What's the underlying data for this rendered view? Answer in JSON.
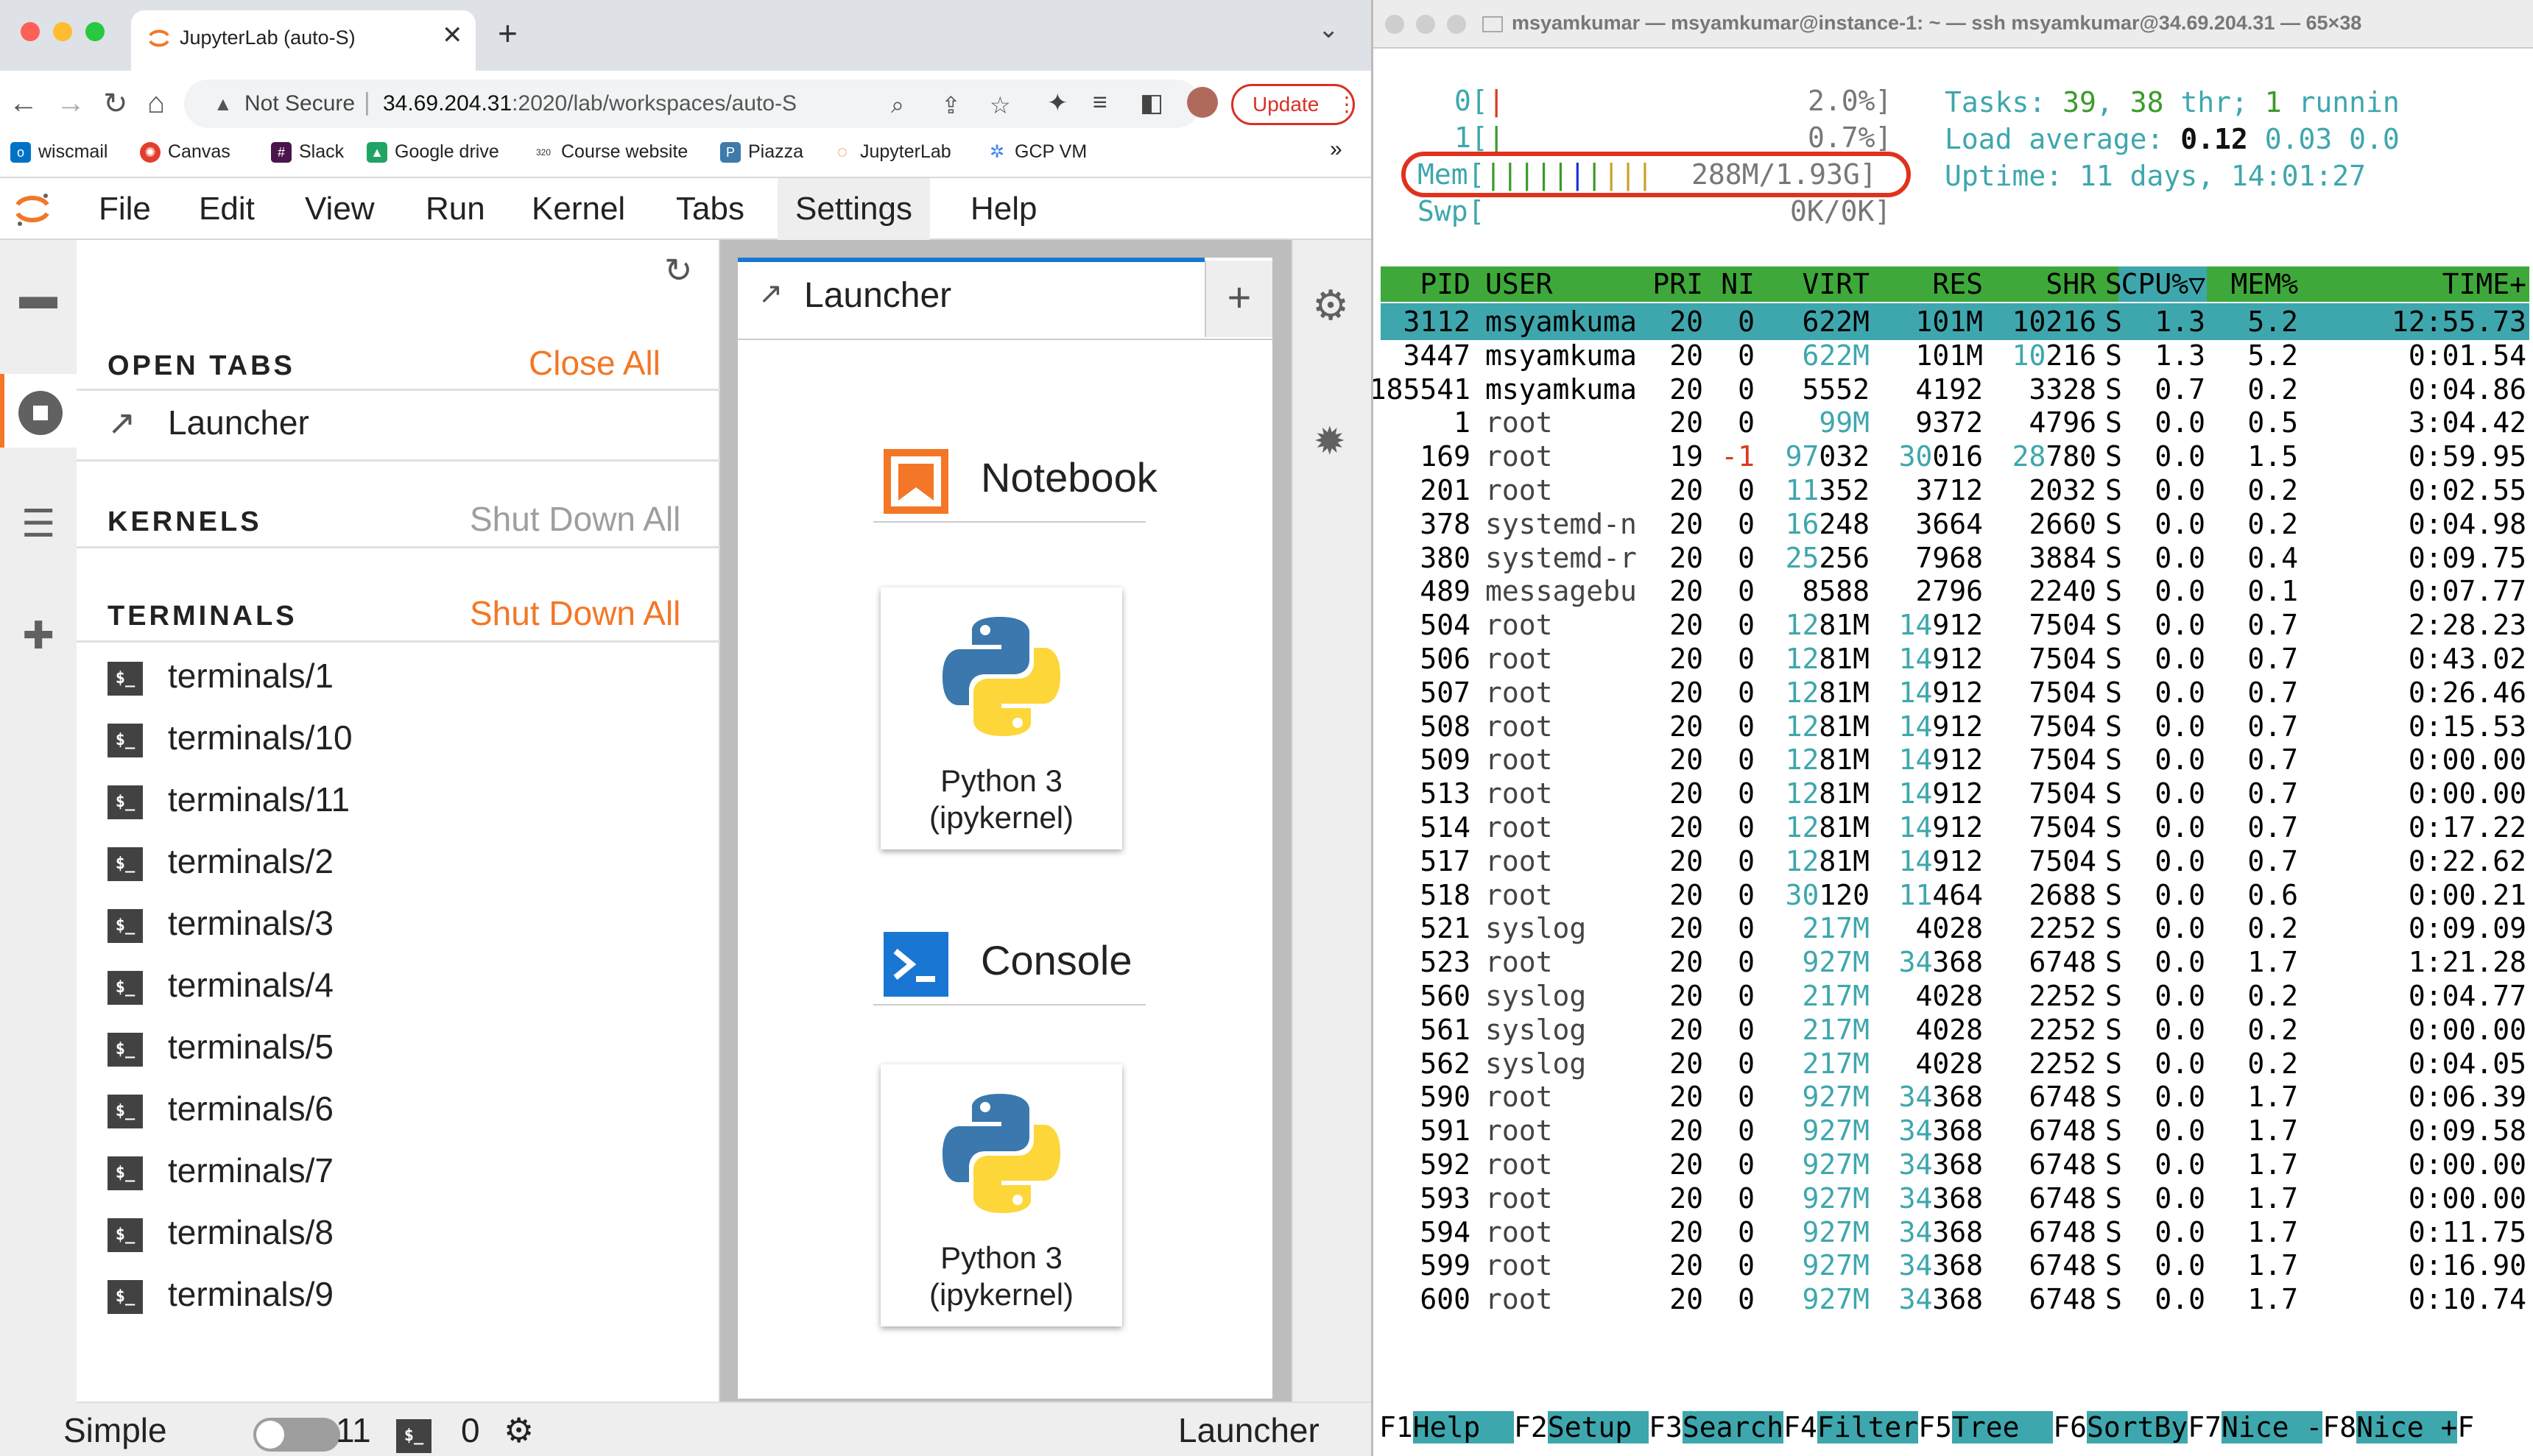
{
  "browser": {
    "tab_title": "JupyterLab (auto-S)",
    "url_security": "Not Secure",
    "url_host": "34.69.204.31",
    "url_path": ":2020/lab/workspaces/auto-S",
    "update_label": "Update",
    "bookmarks": [
      "wiscmail",
      "Canvas",
      "Slack",
      "Google drive",
      "Course website",
      "Piazza",
      "JupyterLab",
      "GCP VM"
    ],
    "bookmarks_more": "»"
  },
  "jupyter": {
    "menus": [
      "File",
      "Edit",
      "View",
      "Run",
      "Kernel",
      "Tabs",
      "Settings",
      "Help"
    ],
    "open_tabs_header": "OPEN TABS",
    "close_all": "Close All",
    "open_tab_item": "Launcher",
    "kernels_header": "KERNELS",
    "kernels_shutdown": "Shut Down All",
    "terminals_header": "TERMINALS",
    "terminals_shutdown": "Shut Down All",
    "terminals": [
      "terminals/1",
      "terminals/10",
      "terminals/11",
      "terminals/2",
      "terminals/3",
      "terminals/4",
      "terminals/5",
      "terminals/6",
      "terminals/7",
      "terminals/8",
      "terminals/9"
    ],
    "terminal_icon_text": "$_",
    "launcher_tab": "Launcher",
    "notebook_section": "Notebook",
    "console_section": "Console",
    "kernel_card_line1": "Python 3",
    "kernel_card_line2": "(ipykernel)",
    "status_simple": "Simple",
    "status_count_terminals": "11",
    "status_count_kernels": "0",
    "status_current": "Launcher"
  },
  "terminal": {
    "window_title": "msyamkumar — msyamkumar@instance-1: ~ — ssh msyamkumar@34.69.204.31 — 65×38",
    "cpu0_label": "0[",
    "cpu0_value": "2.0%]",
    "cpu1_label": "1[",
    "cpu1_value": "0.7%]",
    "mem_label": "Mem[",
    "mem_value": "288M/1.93G]",
    "swp_label": "Swp[",
    "swp_value": "0K/0K]",
    "tasks_label": "Tasks: ",
    "tasks_count": "39",
    "tasks_sep": ", ",
    "threads_count": "38",
    "threads_label": " thr; ",
    "running_count": "1",
    "running_label": " runnin",
    "load_label": "Load average: ",
    "load_1": "0.12",
    "load_5": "0.03",
    "load_15": "0.0",
    "uptime_label": "Uptime: ",
    "uptime_value": "11 days, 14:01:27",
    "columns": [
      "PID",
      "USER",
      "PRI",
      "NI",
      "VIRT",
      "RES",
      "SHR",
      "S",
      "CPU%▽",
      "MEM%",
      "TIME+"
    ],
    "processes": [
      [
        "3112",
        "msyamkuma",
        "20",
        "0",
        "622M",
        "101M",
        "10216",
        "S",
        "1.3",
        "5.2",
        "12:55.73"
      ],
      [
        "3447",
        "msyamkuma",
        "20",
        "0",
        "622M",
        "101M",
        "10216",
        "S",
        "1.3",
        "5.2",
        "0:01.54"
      ],
      [
        "185541",
        "msyamkuma",
        "20",
        "0",
        "5552",
        "4192",
        "3328",
        "S",
        "0.7",
        "0.2",
        "0:04.86"
      ],
      [
        "1",
        "root",
        "20",
        "0",
        "99M",
        "9372",
        "4796",
        "S",
        "0.0",
        "0.5",
        "3:04.42"
      ],
      [
        "169",
        "root",
        "19",
        "-1",
        "97032",
        "30016",
        "28780",
        "S",
        "0.0",
        "1.5",
        "0:59.95"
      ],
      [
        "201",
        "root",
        "20",
        "0",
        "11352",
        "3712",
        "2032",
        "S",
        "0.0",
        "0.2",
        "0:02.55"
      ],
      [
        "378",
        "systemd-n",
        "20",
        "0",
        "16248",
        "3664",
        "2660",
        "S",
        "0.0",
        "0.2",
        "0:04.98"
      ],
      [
        "380",
        "systemd-r",
        "20",
        "0",
        "25256",
        "7968",
        "3884",
        "S",
        "0.0",
        "0.4",
        "0:09.75"
      ],
      [
        "489",
        "messagebu",
        "20",
        "0",
        "8588",
        "2796",
        "2240",
        "S",
        "0.0",
        "0.1",
        "0:07.77"
      ],
      [
        "504",
        "root",
        "20",
        "0",
        "1281M",
        "14912",
        "7504",
        "S",
        "0.0",
        "0.7",
        "2:28.23"
      ],
      [
        "506",
        "root",
        "20",
        "0",
        "1281M",
        "14912",
        "7504",
        "S",
        "0.0",
        "0.7",
        "0:43.02"
      ],
      [
        "507",
        "root",
        "20",
        "0",
        "1281M",
        "14912",
        "7504",
        "S",
        "0.0",
        "0.7",
        "0:26.46"
      ],
      [
        "508",
        "root",
        "20",
        "0",
        "1281M",
        "14912",
        "7504",
        "S",
        "0.0",
        "0.7",
        "0:15.53"
      ],
      [
        "509",
        "root",
        "20",
        "0",
        "1281M",
        "14912",
        "7504",
        "S",
        "0.0",
        "0.7",
        "0:00.00"
      ],
      [
        "513",
        "root",
        "20",
        "0",
        "1281M",
        "14912",
        "7504",
        "S",
        "0.0",
        "0.7",
        "0:00.00"
      ],
      [
        "514",
        "root",
        "20",
        "0",
        "1281M",
        "14912",
        "7504",
        "S",
        "0.0",
        "0.7",
        "0:17.22"
      ],
      [
        "517",
        "root",
        "20",
        "0",
        "1281M",
        "14912",
        "7504",
        "S",
        "0.0",
        "0.7",
        "0:22.62"
      ],
      [
        "518",
        "root",
        "20",
        "0",
        "30120",
        "11464",
        "2688",
        "S",
        "0.0",
        "0.6",
        "0:00.21"
      ],
      [
        "521",
        "syslog",
        "20",
        "0",
        "217M",
        "4028",
        "2252",
        "S",
        "0.0",
        "0.2",
        "0:09.09"
      ],
      [
        "523",
        "root",
        "20",
        "0",
        "927M",
        "34368",
        "6748",
        "S",
        "0.0",
        "1.7",
        "1:21.28"
      ],
      [
        "560",
        "syslog",
        "20",
        "0",
        "217M",
        "4028",
        "2252",
        "S",
        "0.0",
        "0.2",
        "0:04.77"
      ],
      [
        "561",
        "syslog",
        "20",
        "0",
        "217M",
        "4028",
        "2252",
        "S",
        "0.0",
        "0.2",
        "0:00.00"
      ],
      [
        "562",
        "syslog",
        "20",
        "0",
        "217M",
        "4028",
        "2252",
        "S",
        "0.0",
        "0.2",
        "0:04.05"
      ],
      [
        "590",
        "root",
        "20",
        "0",
        "927M",
        "34368",
        "6748",
        "S",
        "0.0",
        "1.7",
        "0:06.39"
      ],
      [
        "591",
        "root",
        "20",
        "0",
        "927M",
        "34368",
        "6748",
        "S",
        "0.0",
        "1.7",
        "0:09.58"
      ],
      [
        "592",
        "root",
        "20",
        "0",
        "927M",
        "34368",
        "6748",
        "S",
        "0.0",
        "1.7",
        "0:00.00"
      ],
      [
        "593",
        "root",
        "20",
        "0",
        "927M",
        "34368",
        "6748",
        "S",
        "0.0",
        "1.7",
        "0:00.00"
      ],
      [
        "594",
        "root",
        "20",
        "0",
        "927M",
        "34368",
        "6748",
        "S",
        "0.0",
        "1.7",
        "0:11.75"
      ],
      [
        "599",
        "root",
        "20",
        "0",
        "927M",
        "34368",
        "6748",
        "S",
        "0.0",
        "1.7",
        "0:16.90"
      ],
      [
        "600",
        "root",
        "20",
        "0",
        "927M",
        "34368",
        "6748",
        "S",
        "0.0",
        "1.7",
        "0:10.74"
      ]
    ],
    "fkeys": [
      [
        "F1",
        "Help  "
      ],
      [
        "F2",
        "Setup "
      ],
      [
        "F3",
        "Search"
      ],
      [
        "F4",
        "Filter"
      ],
      [
        "F5",
        "Tree  "
      ],
      [
        "F6",
        "SortBy"
      ],
      [
        "F7",
        "Nice -"
      ],
      [
        "F8",
        "Nice +"
      ],
      [
        "F",
        ""
      ]
    ]
  },
  "colors": {
    "jupyter_orange": "#f37726",
    "htop_cyan": "#3ea7ad",
    "htop_green": "#3fa83a",
    "annotation_red": "#e0321c"
  }
}
